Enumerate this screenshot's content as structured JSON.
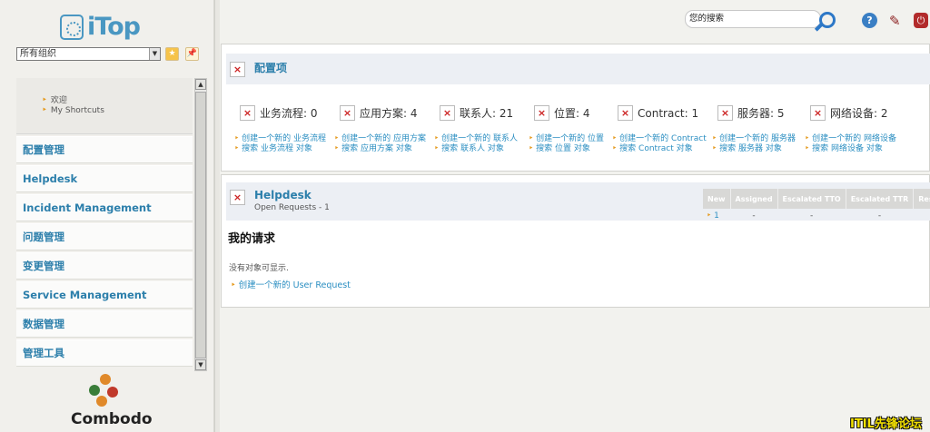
{
  "app": {
    "logo_text": "iTop",
    "vendor_logo_text": "Combodo"
  },
  "org_selector": {
    "value": "所有组织"
  },
  "shortcuts": [
    "欢迎",
    "My Shortcuts"
  ],
  "menu": [
    "配置管理",
    "Helpdesk",
    "Incident Management",
    "问题管理",
    "变更管理",
    "Service Management",
    "数据管理",
    "管理工具"
  ],
  "search": {
    "placeholder": "您的搜索"
  },
  "config_panel": {
    "title": "配置项",
    "stats": [
      {
        "label": "业务流程: 0",
        "create": "创建一个新的 业务流程",
        "search": "搜索 业务流程 对象"
      },
      {
        "label": "应用方案: 4",
        "create": "创建一个新的 应用方案",
        "search": "搜索 应用方案 对象"
      },
      {
        "label": "联系人: 21",
        "create": "创建一个新的 联系人",
        "search": "搜索 联系人 对象"
      },
      {
        "label": "位置: 4",
        "create": "创建一个新的 位置",
        "search": "搜索 位置 对象"
      },
      {
        "label": "Contract: 1",
        "create": "创建一个新的 Contract",
        "search": "搜索 Contract 对象"
      },
      {
        "label": "服务器: 5",
        "create": "创建一个新的 服务器",
        "search": "搜索 服务器 对象"
      },
      {
        "label": "网络设备: 2",
        "create": "创建一个新的 网络设备",
        "search": "搜索 网络设备 对象"
      }
    ]
  },
  "helpdesk_panel": {
    "title": "Helpdesk",
    "subtitle": "Open Requests - 1",
    "table": {
      "headers": [
        "New",
        "Assigned",
        "Escalated TTO",
        "Escalated TTR",
        "Resolve"
      ],
      "row": [
        "1",
        "-",
        "-",
        "-",
        "-"
      ]
    },
    "my_requests_title": "我的请求",
    "no_objects": "没有对象可显示.",
    "create_link": "创建一个新的 User Request"
  },
  "watermark": "ITIL先锋论坛"
}
